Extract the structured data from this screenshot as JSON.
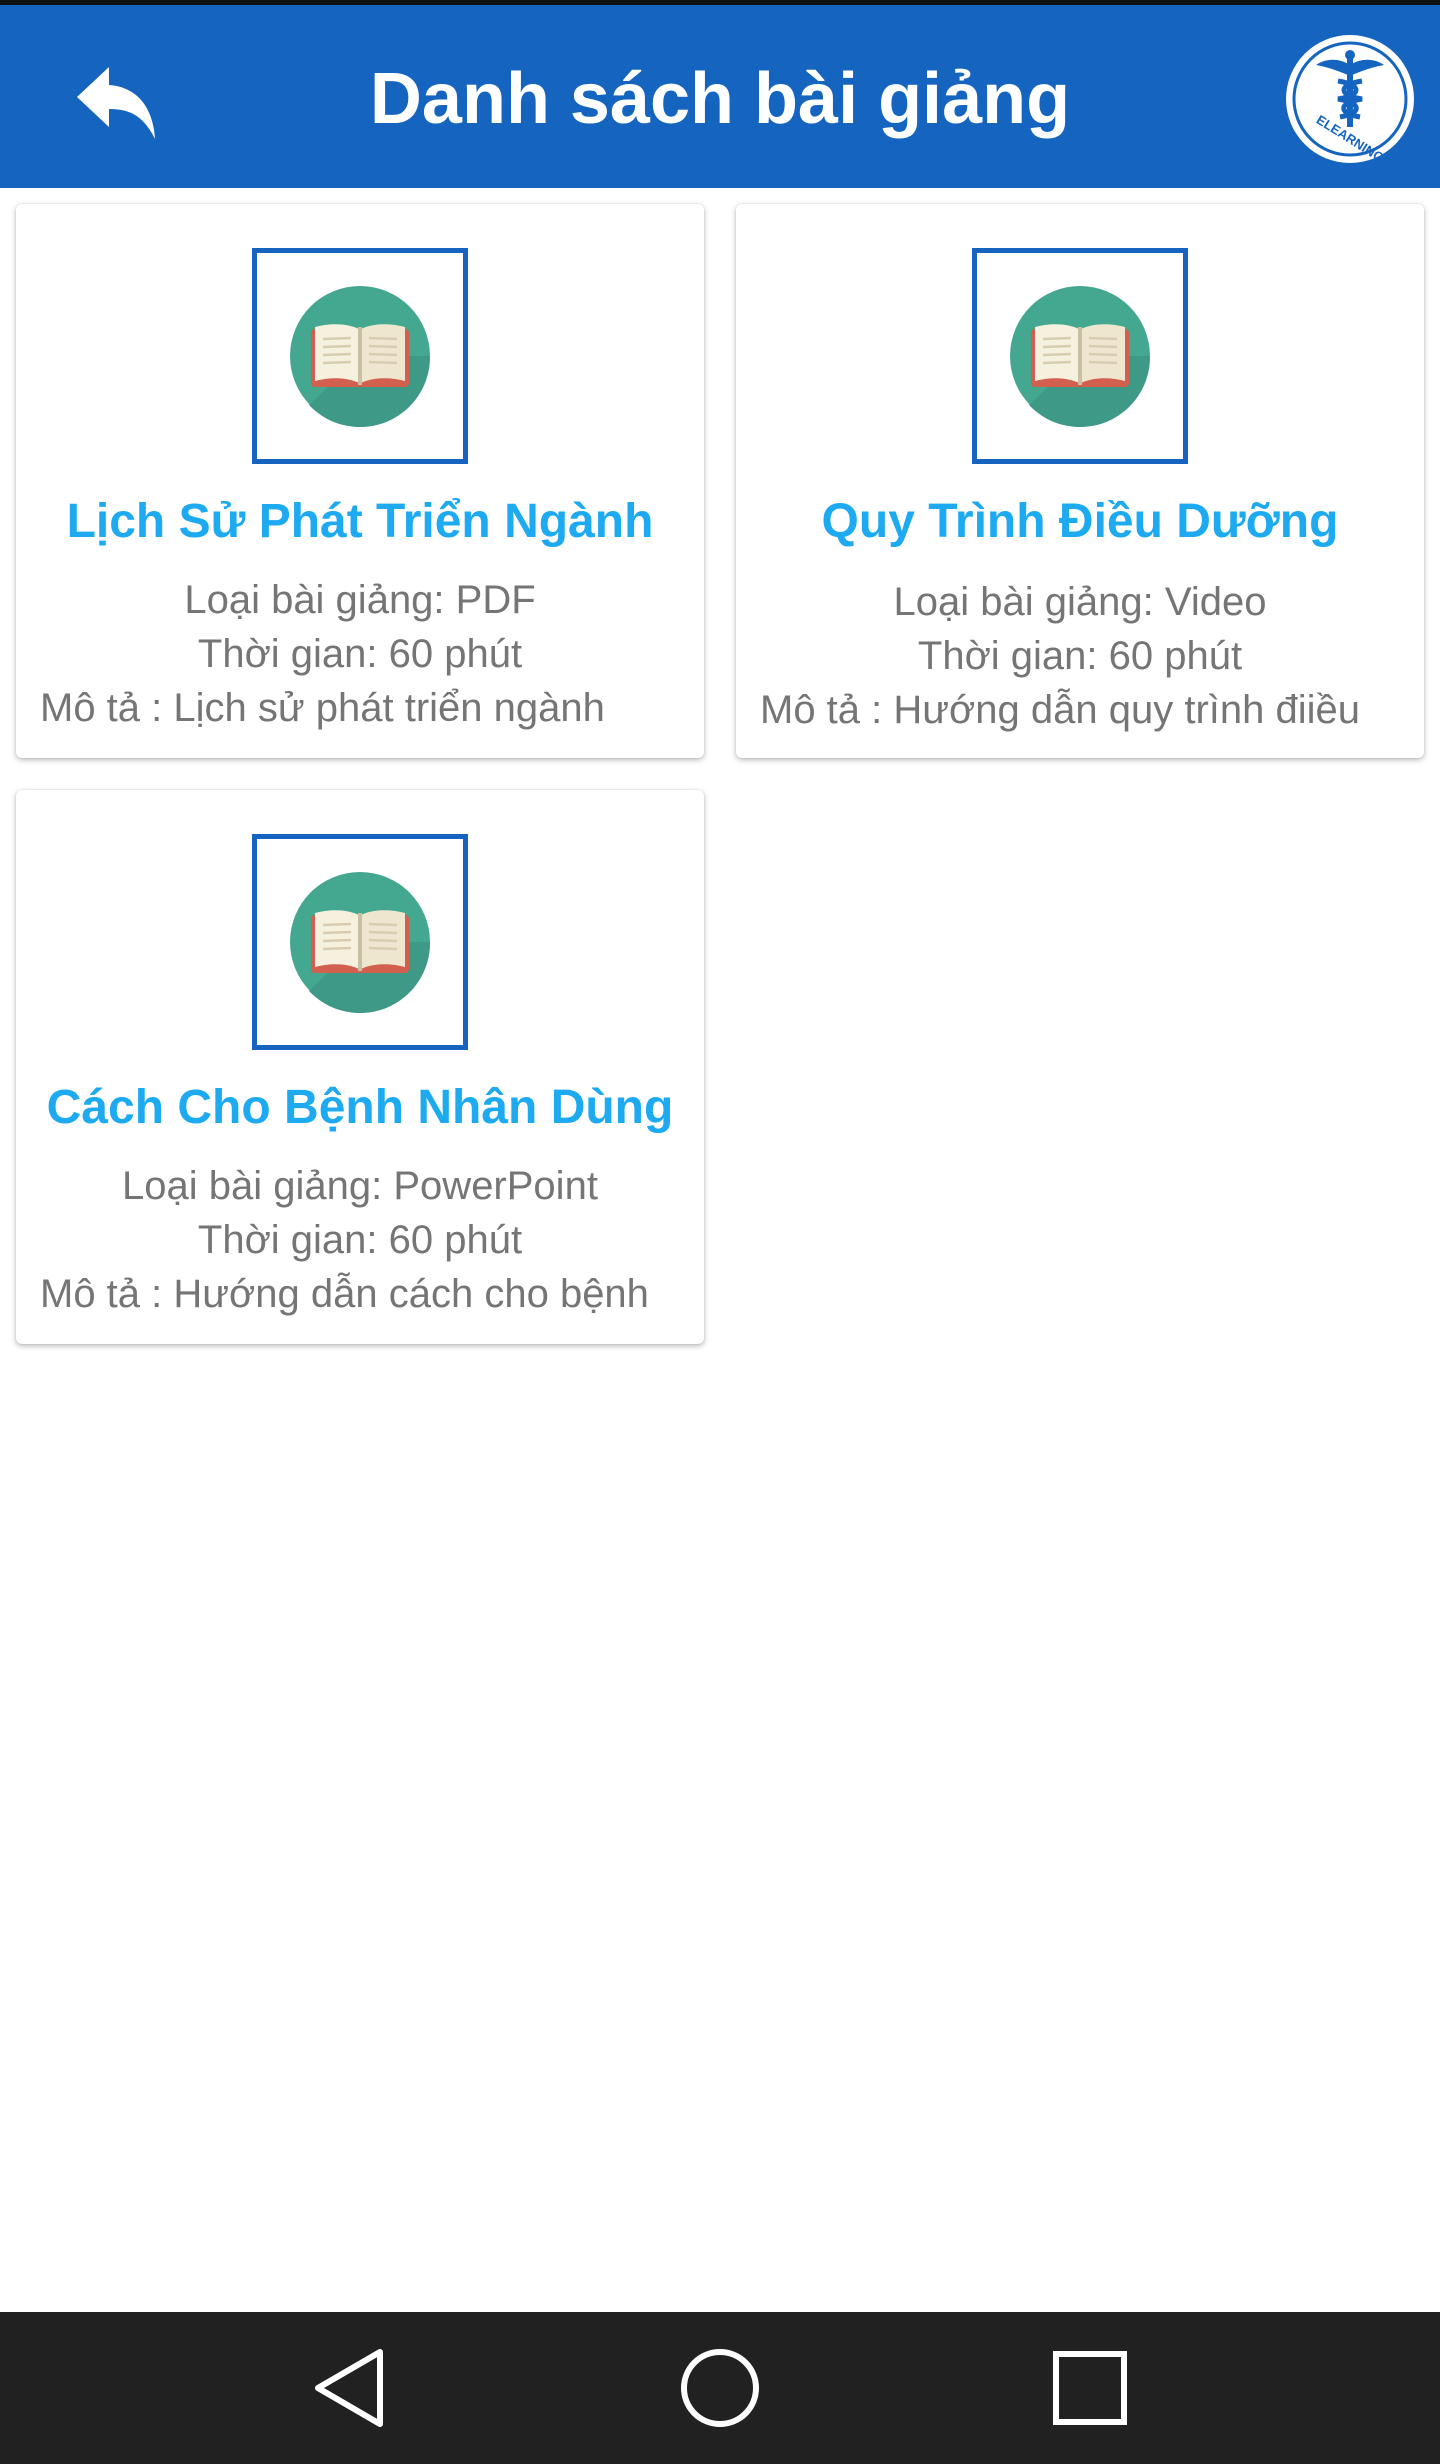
{
  "header": {
    "title": "Danh sách bài giảng",
    "back_icon": "reply-arrow-icon",
    "logo_icon": "caduceus-logo-icon",
    "logo_text": "ELEARNING"
  },
  "colors": {
    "primary": "#1565c0",
    "title_text": "#1eaaf1",
    "body_text": "#757575",
    "nav_bar": "#212121"
  },
  "lessons": [
    {
      "title": "Lịch Sử Phát Triển Ngành",
      "type": "Loại bài giảng: PDF",
      "duration": "Thời gian: 60 phút",
      "description": "Mô tả : Lịch sử phát triển ngành",
      "icon": "open-book-icon"
    },
    {
      "title": "Quy Trình Điều Dưỡng",
      "type": "Loại bài giảng: Video",
      "duration": "Thời gian: 60 phút",
      "description": "Mô tả : Hướng dẫn quy trình điiều",
      "icon": "open-book-icon"
    },
    {
      "title": "Cách Cho Bệnh Nhân Dùng",
      "type": "Loại bài giảng: PowerPoint",
      "duration": "Thời gian: 60 phút",
      "description": "Mô tả : Hướng dẫn cách cho bệnh",
      "icon": "open-book-icon"
    }
  ],
  "navbar": {
    "back_icon": "triangle-back-icon",
    "home_icon": "circle-home-icon",
    "recents_icon": "square-recents-icon"
  }
}
